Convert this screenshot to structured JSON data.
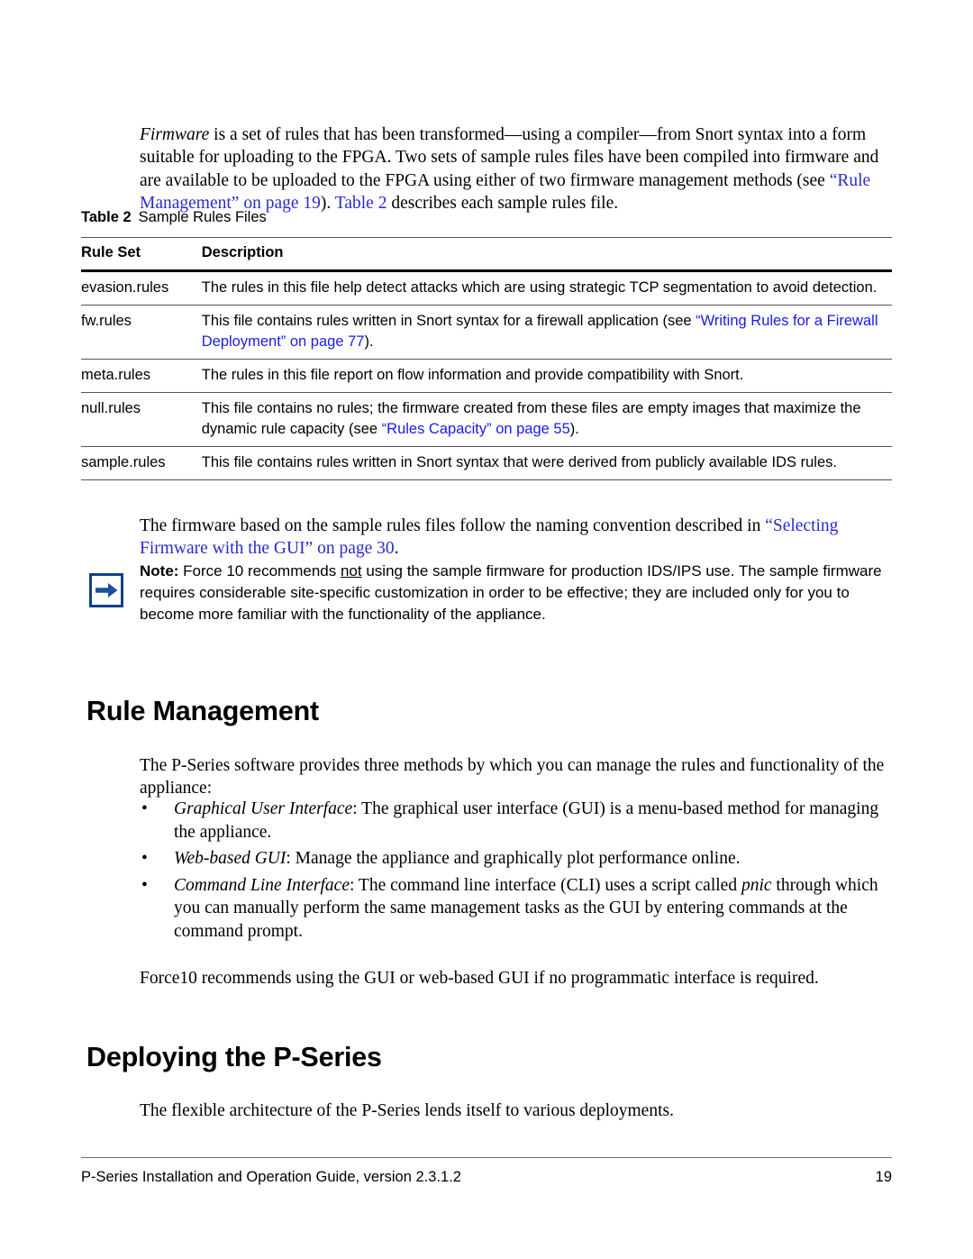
{
  "document": {
    "title": "P-Series Installation and Operation Guide",
    "page_number": "19"
  },
  "intro": {
    "s1": "Firmware",
    "s2": " is a set of rules that has been transformed—using a compiler—from Snort syntax into a form suitable for uploading to the FPGA. Two sets of sample rules files have been compiled into firmware and are available to be uploaded to the FPGA using either of two firmware management methods (see ",
    "link1": "“Rule Management” on page 19",
    "s3": "). ",
    "link2": "Table 2",
    "s4": " describes each sample rules file."
  },
  "table": {
    "caption_label": "Table 2",
    "caption_title": "Sample Rules Files",
    "headers": [
      "Rule Set",
      "Description"
    ],
    "rows": [
      {
        "rule_set": "evasion.rules",
        "desc_pre": "The rules in this file help detect attacks which are using strategic TCP segmentation to avoid detection.",
        "desc_link": "",
        "desc_post": ""
      },
      {
        "rule_set": "fw.rules",
        "desc_pre": "This file contains rules written in Snort syntax for a firewall application (see ",
        "desc_link": "“Writing Rules for a Firewall Deployment” on page 77",
        "desc_post": ")."
      },
      {
        "rule_set": "meta.rules",
        "desc_pre": "The rules in this file report on flow information and provide compatibility with Snort.",
        "desc_link": "",
        "desc_post": ""
      },
      {
        "rule_set": "null.rules",
        "desc_pre": "This file contains no rules; the firmware created from these files are empty images that maximize the dynamic rule capacity (see ",
        "desc_link": "“Rules Capacity” on page 55",
        "desc_post": ")."
      },
      {
        "rule_set": "sample.rules",
        "desc_pre": "This file contains rules written in Snort syntax that were derived from publicly available IDS rules.",
        "desc_link": "",
        "desc_post": ""
      }
    ]
  },
  "firmware_naming": {
    "s1": "The firmware based on the sample rules files follow the naming convention described in ",
    "link1": "“Selecting Firmware with the GUI” on page 30",
    "s2": "."
  },
  "note": {
    "icon": "right-arrow-icon",
    "label": "Note:",
    "s1": " Force 10 recommends ",
    "underlined": "not",
    "s2": " using the sample firmware for production IDS/IPS use. The sample firmware requires considerable site-specific customization in order to be effective; they are included only for you to become more familiar with the functionality of the appliance."
  },
  "rule_management": {
    "heading": "Rule Management",
    "intro": "The P-Series software provides three methods by which you can manage the rules and functionality of the appliance:",
    "bullet_glyph": "•",
    "methods": [
      {
        "term": "Graphical User Interface",
        "body": ": The graphical user interface (GUI) is a menu-based method for managing the appliance."
      },
      {
        "term": "Web-based GUI",
        "body": ": Manage the appliance and graphically plot performance online."
      },
      {
        "term": "Command Line Interface",
        "body_pre": ": The command line interface (CLI) uses a script called ",
        "body_italic": "pnic",
        "body_post": " through which you can manually perform the same management tasks as the GUI by entering commands at the command prompt."
      }
    ],
    "recommendation": "Force10 recommends using the GUI or web-based GUI if no programmatic interface is required."
  },
  "deploying": {
    "heading": "Deploying the P-Series",
    "paragraph": "The flexible architecture of the P-Series lends itself to various deployments."
  },
  "footer": {
    "left": "P-Series Installation and Operation Guide, version 2.3.1.2",
    "right": "19"
  },
  "colors": {
    "serif_link": "#2b2bc8",
    "sans_link": "#1a1aee",
    "note_icon_border": "#123f8c",
    "note_icon_arrow": "#1c4f9c",
    "rule_line": "#555555",
    "footer_rule": "#6f6f6f"
  }
}
